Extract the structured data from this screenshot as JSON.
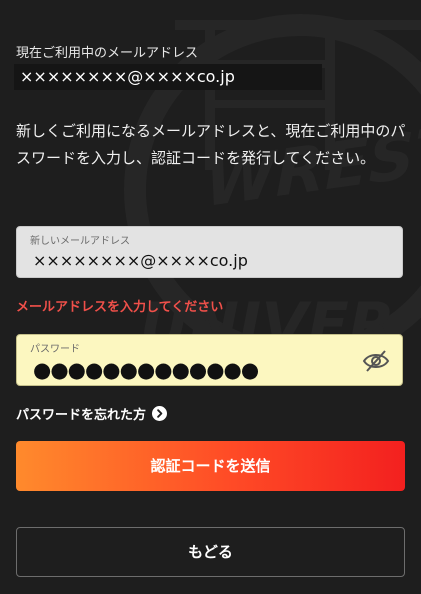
{
  "current_email": {
    "label": "現在ご利用中のメールアドレス",
    "value": "××××××××@××××co.jp"
  },
  "instruction": "新しくご利用になるメールアドレスと、現在ご利用中のパスワードを入力し、認証コードを発行してください。",
  "new_email_field": {
    "label": "新しいメールアドレス",
    "value": "××××××××@××××co.jp"
  },
  "error_message": "メールアドレスを入力してください",
  "password_field": {
    "label": "パスワード",
    "value": "●●●●●●●●●●●●●"
  },
  "forgot_password": {
    "label": "パスワードを忘れた方",
    "icon": "chevron-right-circle-icon"
  },
  "buttons": {
    "send_code": "認証コードを送信",
    "back": "もどる"
  },
  "colors": {
    "background": "#1e1e1e",
    "error": "#f0504a",
    "primary_gradient_start": "#ff8a2c",
    "primary_gradient_end": "#f3201f",
    "password_field_bg": "#fcf7c0",
    "email_field_bg": "#e3e3e3"
  },
  "background_logo": {
    "icon": "wrestle-universe-watermark-icon",
    "text_lines": [
      "WREST",
      "UNIVER"
    ]
  }
}
